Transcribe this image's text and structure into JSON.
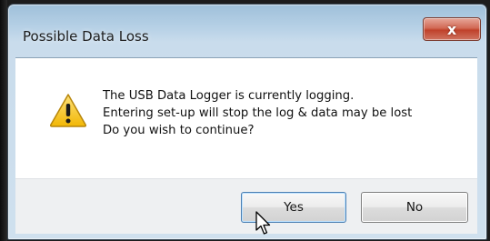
{
  "dialog": {
    "title": "Possible Data Loss",
    "close_label": "x",
    "message_lines": [
      "The USB Data Logger is currently logging.",
      "Entering set-up will stop the log & data may be lost",
      "Do you wish to continue?"
    ],
    "icon": "warning-icon",
    "buttons": {
      "yes": "Yes",
      "no": "No"
    }
  },
  "colors": {
    "title_bar": "#b7d1e6",
    "close_button": "#c0412a",
    "warning_yellow": "#f7c51e",
    "content_bg": "#ffffff",
    "button_bar_bg": "#eef0f2"
  }
}
